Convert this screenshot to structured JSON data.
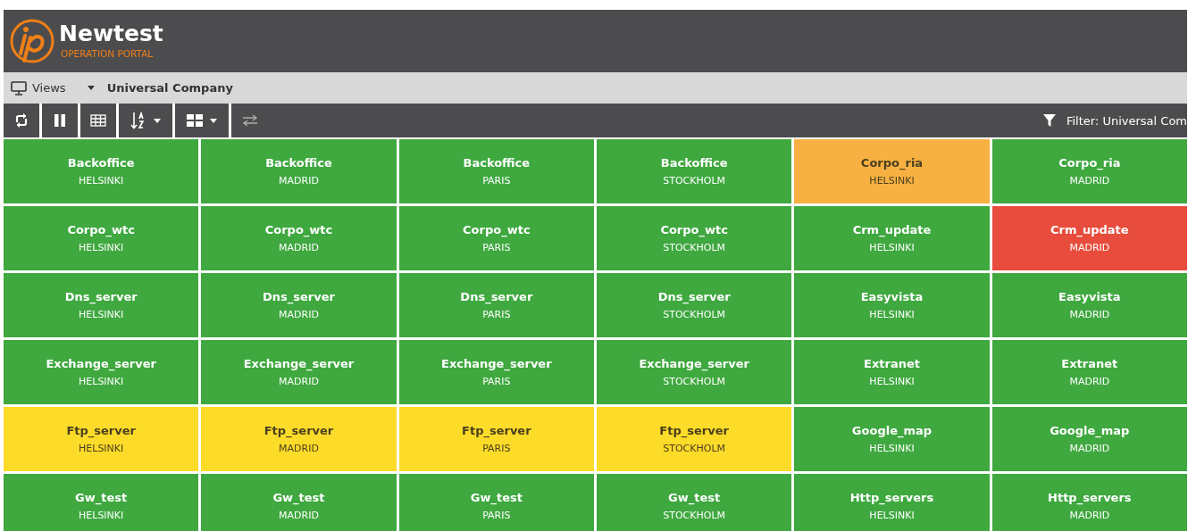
{
  "header": {
    "brand": "Newtest",
    "subtitle": "OPERATION PORTAL"
  },
  "views_bar": {
    "views_label": "Views",
    "selected_view": "Universal Company"
  },
  "toolbar": {
    "filter": "Filter: Universal Com"
  },
  "tiles": [
    {
      "name": "Backoffice",
      "location": "HELSINKI",
      "color": "#3fa83f"
    },
    {
      "name": "Backoffice",
      "location": "MADRID",
      "color": "#3fa83f"
    },
    {
      "name": "Backoffice",
      "location": "PARIS",
      "color": "#3fa83f"
    },
    {
      "name": "Backoffice",
      "location": "STOCKHOLM",
      "color": "#3fa83f"
    },
    {
      "name": "Corpo_ria",
      "location": "HELSINKI",
      "color": "#f7b142"
    },
    {
      "name": "Corpo_ria",
      "location": "MADRID",
      "color": "#3fa83f"
    },
    {
      "name": "Corpo_wtc",
      "location": "HELSINKI",
      "color": "#3fa83f"
    },
    {
      "name": "Corpo_wtc",
      "location": "MADRID",
      "color": "#3fa83f"
    },
    {
      "name": "Corpo_wtc",
      "location": "PARIS",
      "color": "#3fa83f"
    },
    {
      "name": "Corpo_wtc",
      "location": "STOCKHOLM",
      "color": "#3fa83f"
    },
    {
      "name": "Crm_update",
      "location": "HELSINKI",
      "color": "#3fa83f"
    },
    {
      "name": "Crm_update",
      "location": "MADRID",
      "color": "#e74c3c"
    },
    {
      "name": "Dns_server",
      "location": "HELSINKI",
      "color": "#3fa83f"
    },
    {
      "name": "Dns_server",
      "location": "MADRID",
      "color": "#3fa83f"
    },
    {
      "name": "Dns_server",
      "location": "PARIS",
      "color": "#3fa83f"
    },
    {
      "name": "Dns_server",
      "location": "STOCKHOLM",
      "color": "#3fa83f"
    },
    {
      "name": "Easyvista",
      "location": "HELSINKI",
      "color": "#3fa83f"
    },
    {
      "name": "Easyvista",
      "location": "MADRID",
      "color": "#3fa83f"
    },
    {
      "name": "Exchange_server",
      "location": "HELSINKI",
      "color": "#3fa83f"
    },
    {
      "name": "Exchange_server",
      "location": "MADRID",
      "color": "#3fa83f"
    },
    {
      "name": "Exchange_server",
      "location": "PARIS",
      "color": "#3fa83f"
    },
    {
      "name": "Exchange_server",
      "location": "STOCKHOLM",
      "color": "#3fa83f"
    },
    {
      "name": "Extranet",
      "location": "HELSINKI",
      "color": "#3fa83f"
    },
    {
      "name": "Extranet",
      "location": "MADRID",
      "color": "#3fa83f"
    },
    {
      "name": "Ftp_server",
      "location": "HELSINKI",
      "color": "#fddb29"
    },
    {
      "name": "Ftp_server",
      "location": "MADRID",
      "color": "#fddb29"
    },
    {
      "name": "Ftp_server",
      "location": "PARIS",
      "color": "#fddb29"
    },
    {
      "name": "Ftp_server",
      "location": "STOCKHOLM",
      "color": "#fddb29"
    },
    {
      "name": "Google_map",
      "location": "HELSINKI",
      "color": "#3fa83f"
    },
    {
      "name": "Google_map",
      "location": "MADRID",
      "color": "#3fa83f"
    },
    {
      "name": "Gw_test",
      "location": "HELSINKI",
      "color": "#3fa83f"
    },
    {
      "name": "Gw_test",
      "location": "MADRID",
      "color": "#3fa83f"
    },
    {
      "name": "Gw_test",
      "location": "PARIS",
      "color": "#3fa83f"
    },
    {
      "name": "Gw_test",
      "location": "STOCKHOLM",
      "color": "#3fa83f"
    },
    {
      "name": "Http_servers",
      "location": "HELSINKI",
      "color": "#3fa83f"
    },
    {
      "name": "Http_servers",
      "location": "MADRID",
      "color": "#3fa83f"
    }
  ]
}
